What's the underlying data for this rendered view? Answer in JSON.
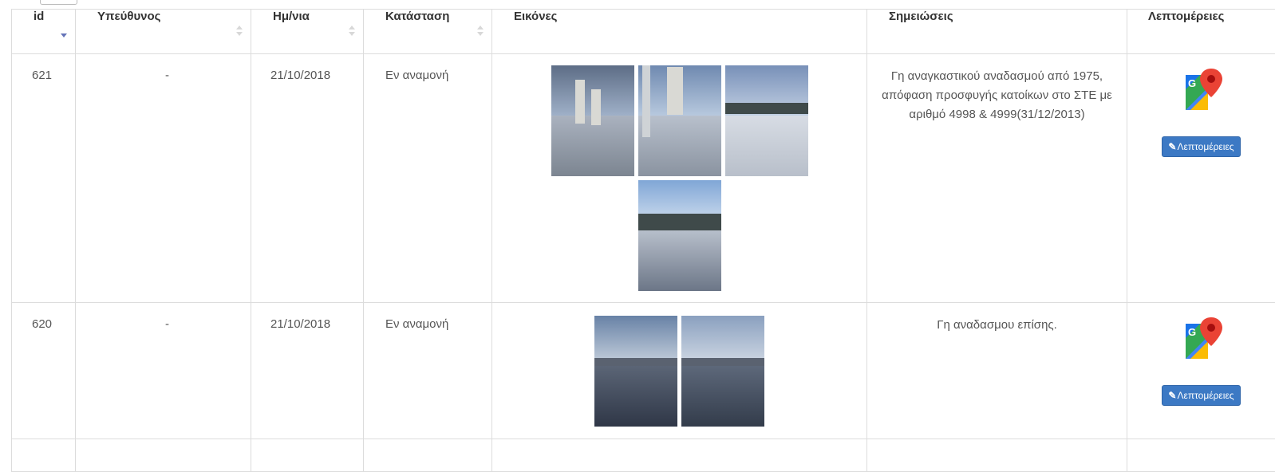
{
  "table": {
    "headers": {
      "id": "id",
      "owner": "Υπεύθυνος",
      "date": "Ημ/νια",
      "status": "Κατάσταση",
      "images": "Εικόνες",
      "notes": "Σημειώσεις",
      "details": "Λεπτομέρειες"
    },
    "rows": [
      {
        "id": "621",
        "owner": "-",
        "date": "21/10/2018",
        "status": "Εν αναμονή",
        "notes": "Γη αναγκαστικού αναδασμού από 1975, απόφαση προσφυγής κατοίκων στο ΣΤΕ με αριθμό 4998 & 4999(31/12/2013)",
        "image_count": 4,
        "details_button": "Λεπτομέρειες"
      },
      {
        "id": "620",
        "owner": "-",
        "date": "21/10/2018",
        "status": "Εν αναμονή",
        "notes": "Γη αναδασμου επίσης.",
        "image_count": 2,
        "details_button": "Λεπτομέρειες"
      }
    ]
  },
  "icons": {
    "sort_active": "sort-desc-icon",
    "sort_inactive": "sort-both-icon",
    "map": "google-maps-icon",
    "edit": "edit-icon"
  },
  "colors": {
    "button": "#3c79c4",
    "sort_active": "#6574b8",
    "border": "#dcdcdc"
  }
}
